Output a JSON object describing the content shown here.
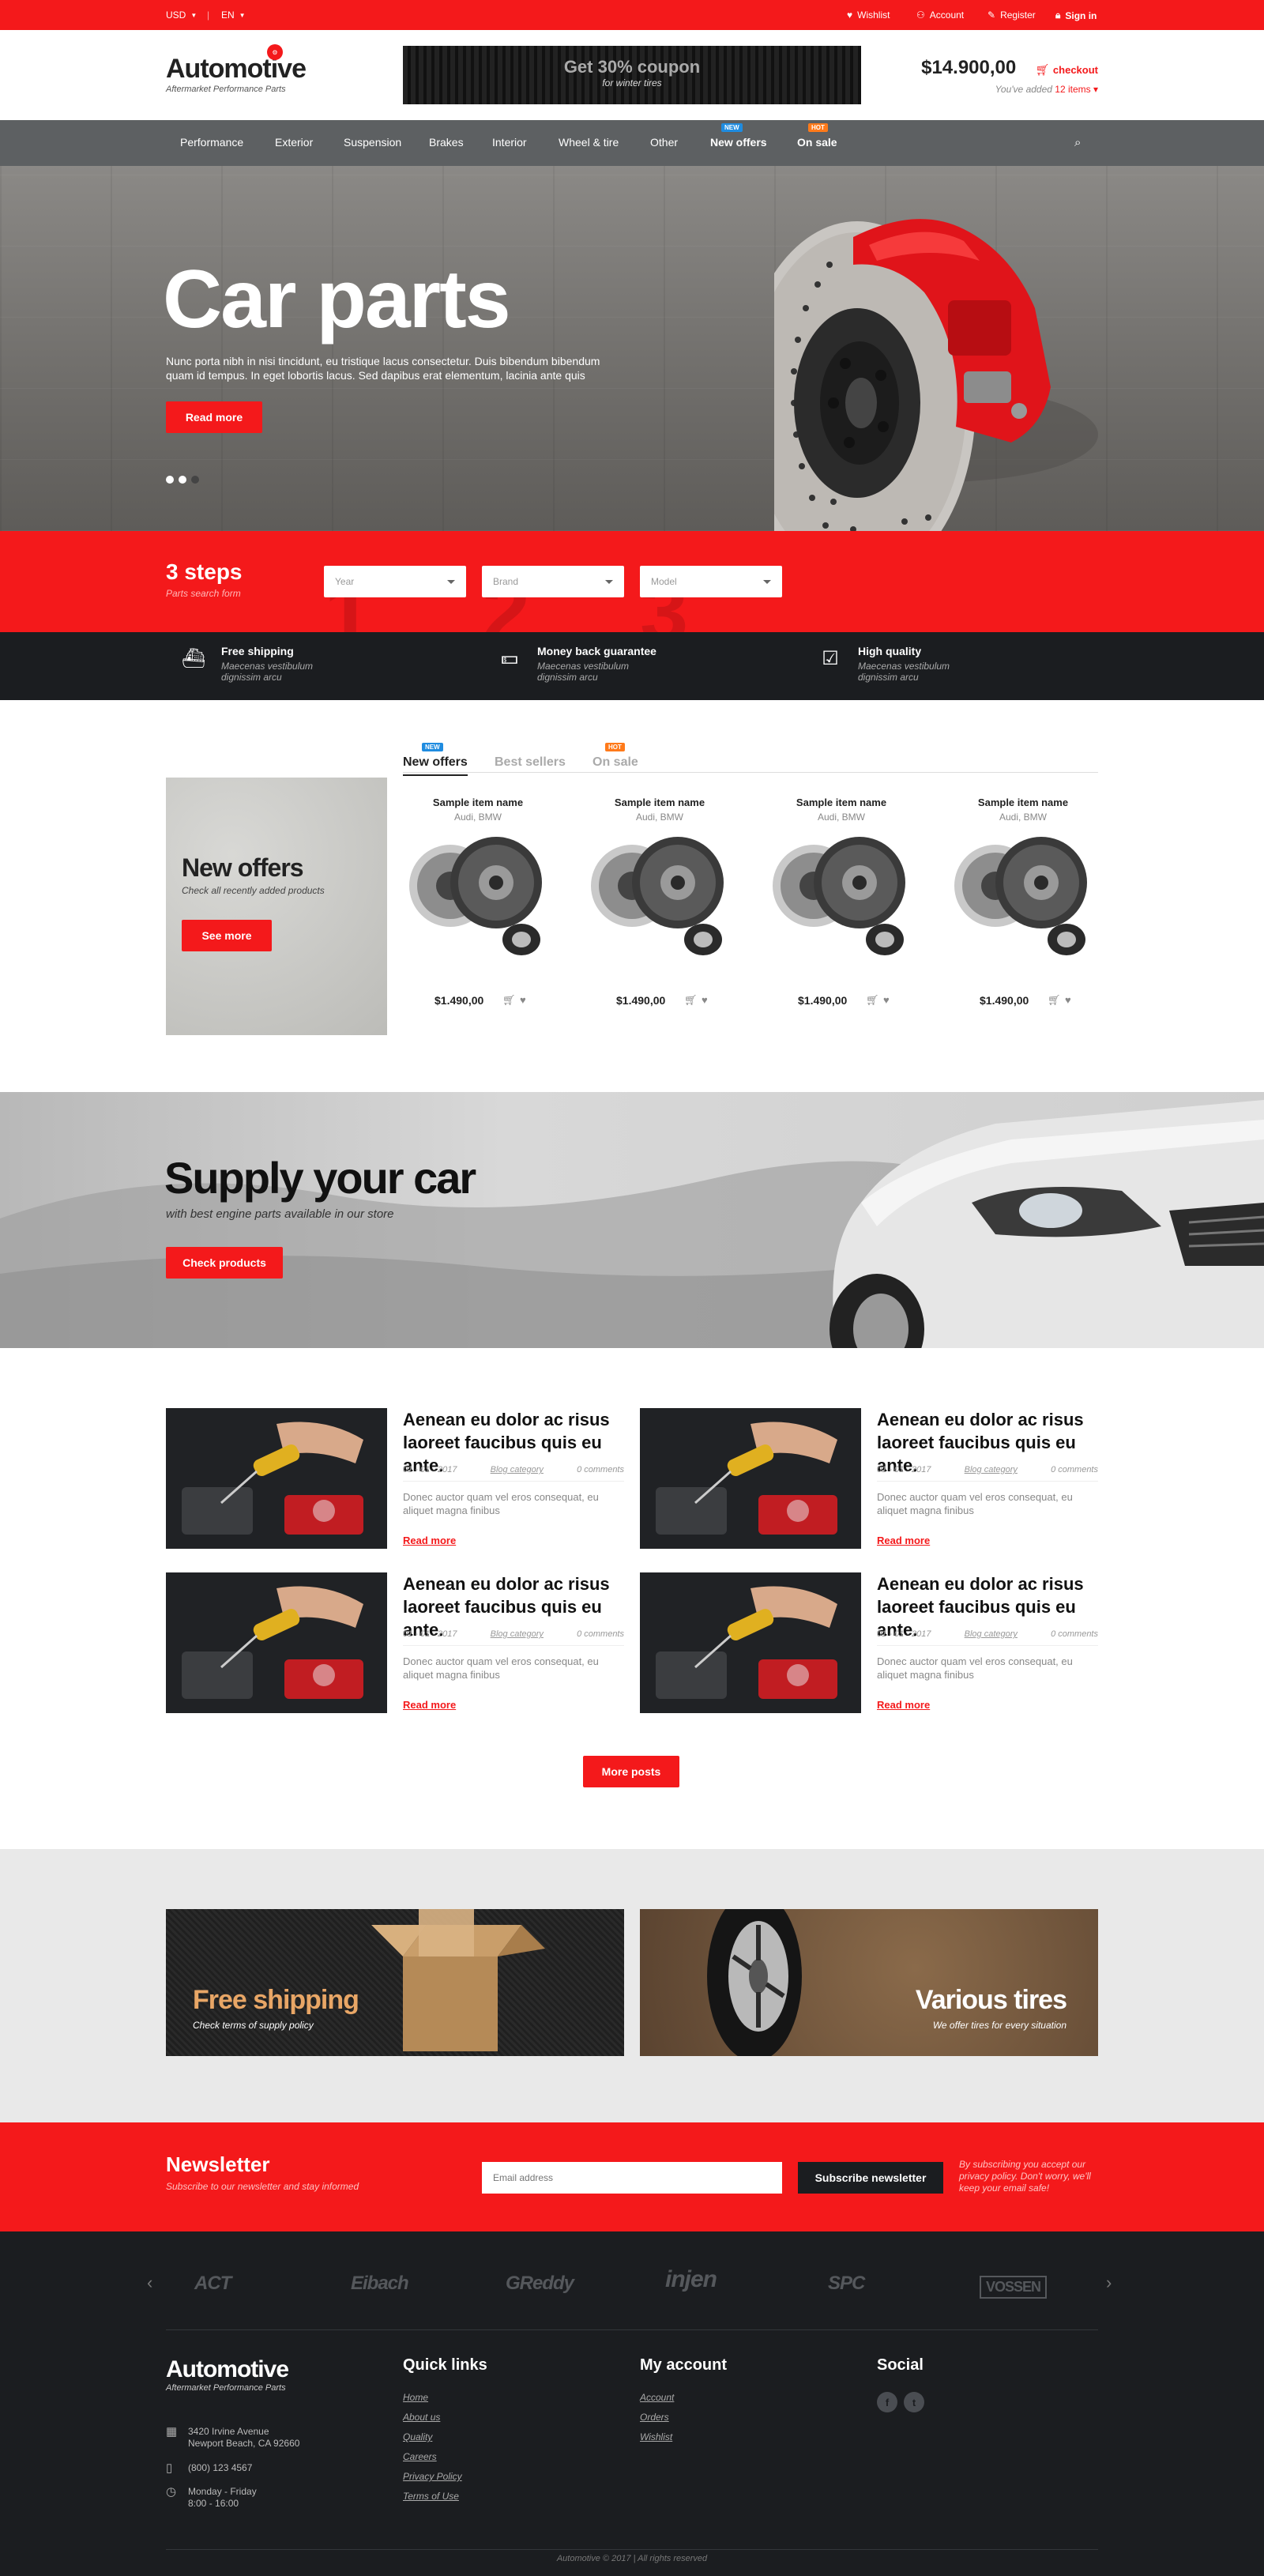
{
  "topbar": {
    "currency": "USD",
    "language": "EN",
    "wishlist": "Wishlist",
    "account": "Account",
    "register": "Register",
    "signin": "Sign in"
  },
  "header": {
    "logo": "Automotive",
    "logo_tagline": "Aftermarket Performance Parts",
    "coupon_title": "Get 30% coupon",
    "coupon_sub": "for winter tires",
    "cart_total": "$14.900,00",
    "checkout": "checkout",
    "cart_added_prefix": "You've added",
    "cart_items": "12 items"
  },
  "nav": {
    "items": [
      "Performance",
      "Exterior",
      "Suspension",
      "Brakes",
      "Interior",
      "Wheel & tire",
      "Other",
      "New offers",
      "On sale"
    ],
    "badges": {
      "new": "NEW",
      "hot": "HOT"
    }
  },
  "hero": {
    "title": "Car parts",
    "text": "Nunc porta nibh in nisi tincidunt, eu tristique lacus consectetur. Duis bibendum bibendum quam id tempus. In eget lobortis lacus. Sed dapibus erat elementum, lacinia ante quis",
    "button": "Read more"
  },
  "steps": {
    "title": "3 steps",
    "subtitle": "Parts search form",
    "selects": [
      "Year",
      "Brand",
      "Model"
    ],
    "digits": [
      "1",
      "2",
      "3"
    ]
  },
  "features": [
    {
      "title": "Free shipping",
      "desc": "Maecenas vestibulum dignissim arcu",
      "icon": "ship-icon"
    },
    {
      "title": "Money back guarantee",
      "desc": "Maecenas vestibulum dignissim arcu",
      "icon": "money-icon"
    },
    {
      "title": "High quality",
      "desc": "Maecenas vestibulum dignissim arcu",
      "icon": "checkbox-icon"
    }
  ],
  "products": {
    "tabs": [
      "New offers",
      "Best sellers",
      "On sale"
    ],
    "promo_title": "New offers",
    "promo_sub": "Check all recently added products",
    "promo_button": "See more",
    "items": [
      {
        "name": "Sample item name",
        "brand": "Audi, BMW",
        "price": "$1.490,00"
      },
      {
        "name": "Sample item name",
        "brand": "Audi, BMW",
        "price": "$1.490,00"
      },
      {
        "name": "Sample item name",
        "brand": "Audi, BMW",
        "price": "$1.490,00"
      },
      {
        "name": "Sample item name",
        "brand": "Audi, BMW",
        "price": "$1.490,00"
      }
    ]
  },
  "supply": {
    "title": "Supply your car",
    "subtitle": "with best engine parts available in our store",
    "button": "Check products"
  },
  "blog": {
    "posts": [
      {
        "title": "Aenean eu dolor ac risus laoreet faucibus quis eu ante.",
        "date": "01 - 01 - 2017",
        "category": "Blog category",
        "comments": "0 comments",
        "excerpt": "Donec auctor quam vel eros consequat, eu aliquet magna finibus",
        "more": "Read more"
      },
      {
        "title": "Aenean eu dolor ac risus laoreet faucibus quis eu ante.",
        "date": "01 - 01 - 2017",
        "category": "Blog category",
        "comments": "0 comments",
        "excerpt": "Donec auctor quam vel eros consequat, eu aliquet magna finibus",
        "more": "Read more"
      },
      {
        "title": "Aenean eu dolor ac risus laoreet faucibus quis eu ante.",
        "date": "01 - 01 - 2017",
        "category": "Blog category",
        "comments": "0 comments",
        "excerpt": "Donec auctor quam vel eros consequat, eu aliquet magna finibus",
        "more": "Read more"
      },
      {
        "title": "Aenean eu dolor ac risus laoreet faucibus quis eu ante.",
        "date": "01 - 01 - 2017",
        "category": "Blog category",
        "comments": "0 comments",
        "excerpt": "Donec auctor quam vel eros consequat, eu aliquet magna finibus",
        "more": "Read more"
      }
    ],
    "more_button": "More posts"
  },
  "banners": [
    {
      "title": "Free shipping",
      "subtitle": "Check terms of supply policy"
    },
    {
      "title": "Various tires",
      "subtitle": "We offer tires for every situation"
    }
  ],
  "newsletter": {
    "title": "Newsletter",
    "subtitle": "Subscribe to our newsletter and stay informed",
    "placeholder": "Email address",
    "button": "Subscribe newsletter",
    "note": "By subscribing you accept our privacy policy. Don't worry, we'll keep your email safe!"
  },
  "brands": [
    "ACT",
    "Eibach",
    "GReddy",
    "injen",
    "SPC",
    "VOSSEN"
  ],
  "footer": {
    "logo": "Automotive",
    "tagline": "Aftermarket Performance Parts",
    "address": "3420 Irvine Avenue",
    "address2": "Newport Beach, CA 92660",
    "phone": "(800) 123 4567",
    "hours": "Monday - Friday",
    "hours2": "8:00 - 16:00",
    "quick_title": "Quick links",
    "quick": [
      "Home",
      "About us",
      "Quality",
      "Careers",
      "Privacy Policy",
      "Terms of Use"
    ],
    "account_title": "My account",
    "account": [
      "Account",
      "Orders",
      "Wishlist"
    ],
    "social_title": "Social",
    "social_icons": [
      "facebook-icon",
      "twitter-icon"
    ],
    "copyright": "Automotive © 2017   |   All rights reserved"
  },
  "colors": {
    "accent": "#f4191b",
    "dark": "#1b1d20",
    "nav": "#5d6062",
    "new_badge": "#1f8ce0",
    "hot_badge": "#ff7a1a"
  }
}
